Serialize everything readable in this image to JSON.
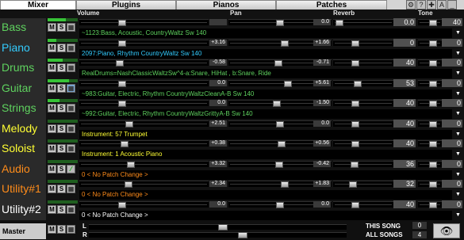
{
  "tabs": [
    "Mixer",
    "Plugins",
    "Pianos",
    "Patches"
  ],
  "toolbar_icons": [
    "gear",
    "help",
    "add",
    "A",
    "minimize"
  ],
  "toolbar_glyphs": [
    "⚙",
    "?",
    "✚",
    "A",
    "_"
  ],
  "headers": {
    "volume": "Volume",
    "pan": "Pan",
    "reverb": "Reverb",
    "tone": "Tone"
  },
  "tracks": [
    {
      "name": "Bass",
      "color": "#5fd35f",
      "btn3": "grid",
      "meter": 0.6,
      "vol": "",
      "pan": "0.0",
      "rev": "0.0",
      "tone": "40",
      "volPos": 0.32,
      "panPos": 0.5,
      "revPos": 0.05,
      "tonePos": 0.72,
      "patch": "~1123:Bass, Acoustic, CountryWaltz Sw 140",
      "patchColor": "#5fd35f"
    },
    {
      "name": "Piano",
      "color": "#33ccff",
      "btn3": "grid",
      "meter": 0.3,
      "vol": "+3.16",
      "pan": "+1.66",
      "rev": "0",
      "tone": "0",
      "volPos": 0.32,
      "panPos": 0.55,
      "revPos": 0.35,
      "tonePos": 0.72,
      "patch": "2097:Piano, Rhythm CountryWaltz Sw 140",
      "patchColor": "#33ccff"
    },
    {
      "name": "Drums",
      "color": "#5fd35f",
      "btn3": "grid",
      "meter": 0.5,
      "vol": "-0.58",
      "pan": "-0.71",
      "rev": "40",
      "tone": "0",
      "volPos": 0.3,
      "panPos": 0.48,
      "revPos": 0.35,
      "tonePos": 0.72,
      "patch": "RealDrums=NashClassicWaltzSw^4-a:Snare, HiHat , b:Snare, Ride",
      "patchColor": "#5fd35f"
    },
    {
      "name": "Guitar",
      "color": "#5fd35f",
      "btn3": "blue",
      "meter": 0.7,
      "vol": "0.0",
      "pan": "+5.61",
      "rev": "53",
      "tone": "0",
      "volPos": 0.32,
      "panPos": 0.58,
      "revPos": 0.4,
      "tonePos": 0.72,
      "patch": "~983:Guitar, Electric, Rhythm CountryWaltzCleanA-B Sw 140",
      "patchColor": "#5fd35f"
    },
    {
      "name": "Strings",
      "color": "#5fd35f",
      "btn3": "grid",
      "meter": 0.4,
      "vol": "0.0",
      "pan": "-1.50",
      "rev": "40",
      "tone": "0",
      "volPos": 0.32,
      "panPos": 0.47,
      "revPos": 0.35,
      "tonePos": 0.72,
      "patch": "~992:Guitar, Electric, Rhythm CountryWaltzGrittyA-B Sw 140",
      "patchColor": "#5fd35f"
    },
    {
      "name": "Melody",
      "color": "#ffff33",
      "btn3": "grid",
      "meter": 0.0,
      "vol": "+2.51",
      "pan": "0.0",
      "rev": "40",
      "tone": "0",
      "volPos": 0.38,
      "panPos": 0.5,
      "revPos": 0.35,
      "tonePos": 0.72,
      "patch": "Instrument: 57 Trumpet",
      "patchColor": "#ffff33"
    },
    {
      "name": "Soloist",
      "color": "#ffff33",
      "btn3": "grid",
      "meter": 0.0,
      "vol": "+0.38",
      "pan": "+0.56",
      "rev": "40",
      "tone": "0",
      "volPos": 0.34,
      "panPos": 0.52,
      "revPos": 0.35,
      "tonePos": 0.72,
      "patch": "Instrument: 1 Acoustic Piano",
      "patchColor": "#ffff33"
    },
    {
      "name": "Audio",
      "color": "#ff8c1a",
      "btn3": "green",
      "meter": 0.0,
      "vol": "+3.32",
      "pan": "-0.42",
      "rev": "36",
      "tone": "0",
      "volPos": 0.39,
      "panPos": 0.49,
      "revPos": 0.33,
      "tonePos": 0.72,
      "patch": "0 < No Patch Change >",
      "patchColor": "#ff8c1a"
    },
    {
      "name": "Utility#1",
      "color": "#ff8c1a",
      "btn3": "grid",
      "meter": 0.0,
      "vol": "+2.34",
      "pan": "+1.83",
      "rev": "32",
      "tone": "0",
      "volPos": 0.37,
      "panPos": 0.55,
      "revPos": 0.3,
      "tonePos": 0.72,
      "patch": "0 < No Patch Change >",
      "patchColor": "#ff8c1a"
    },
    {
      "name": "Utility#2",
      "color": "#ffffff",
      "btn3": "grid",
      "meter": 0.0,
      "vol": "0.0",
      "pan": "0.0",
      "rev": "40",
      "tone": "0",
      "volPos": 0.32,
      "panPos": 0.5,
      "revPos": 0.35,
      "tonePos": 0.72,
      "patch": "0 < No Patch Change >",
      "patchColor": "#ffffff"
    }
  ],
  "master": {
    "label": "Master",
    "l": "L",
    "r": "R",
    "this_song": "THIS SONG",
    "all_songs": "ALL SONGS",
    "this_song_val": "0",
    "all_songs_val": "4",
    "lPos": 0.52,
    "rPos": 0.6
  },
  "eye_glyph": "👁"
}
